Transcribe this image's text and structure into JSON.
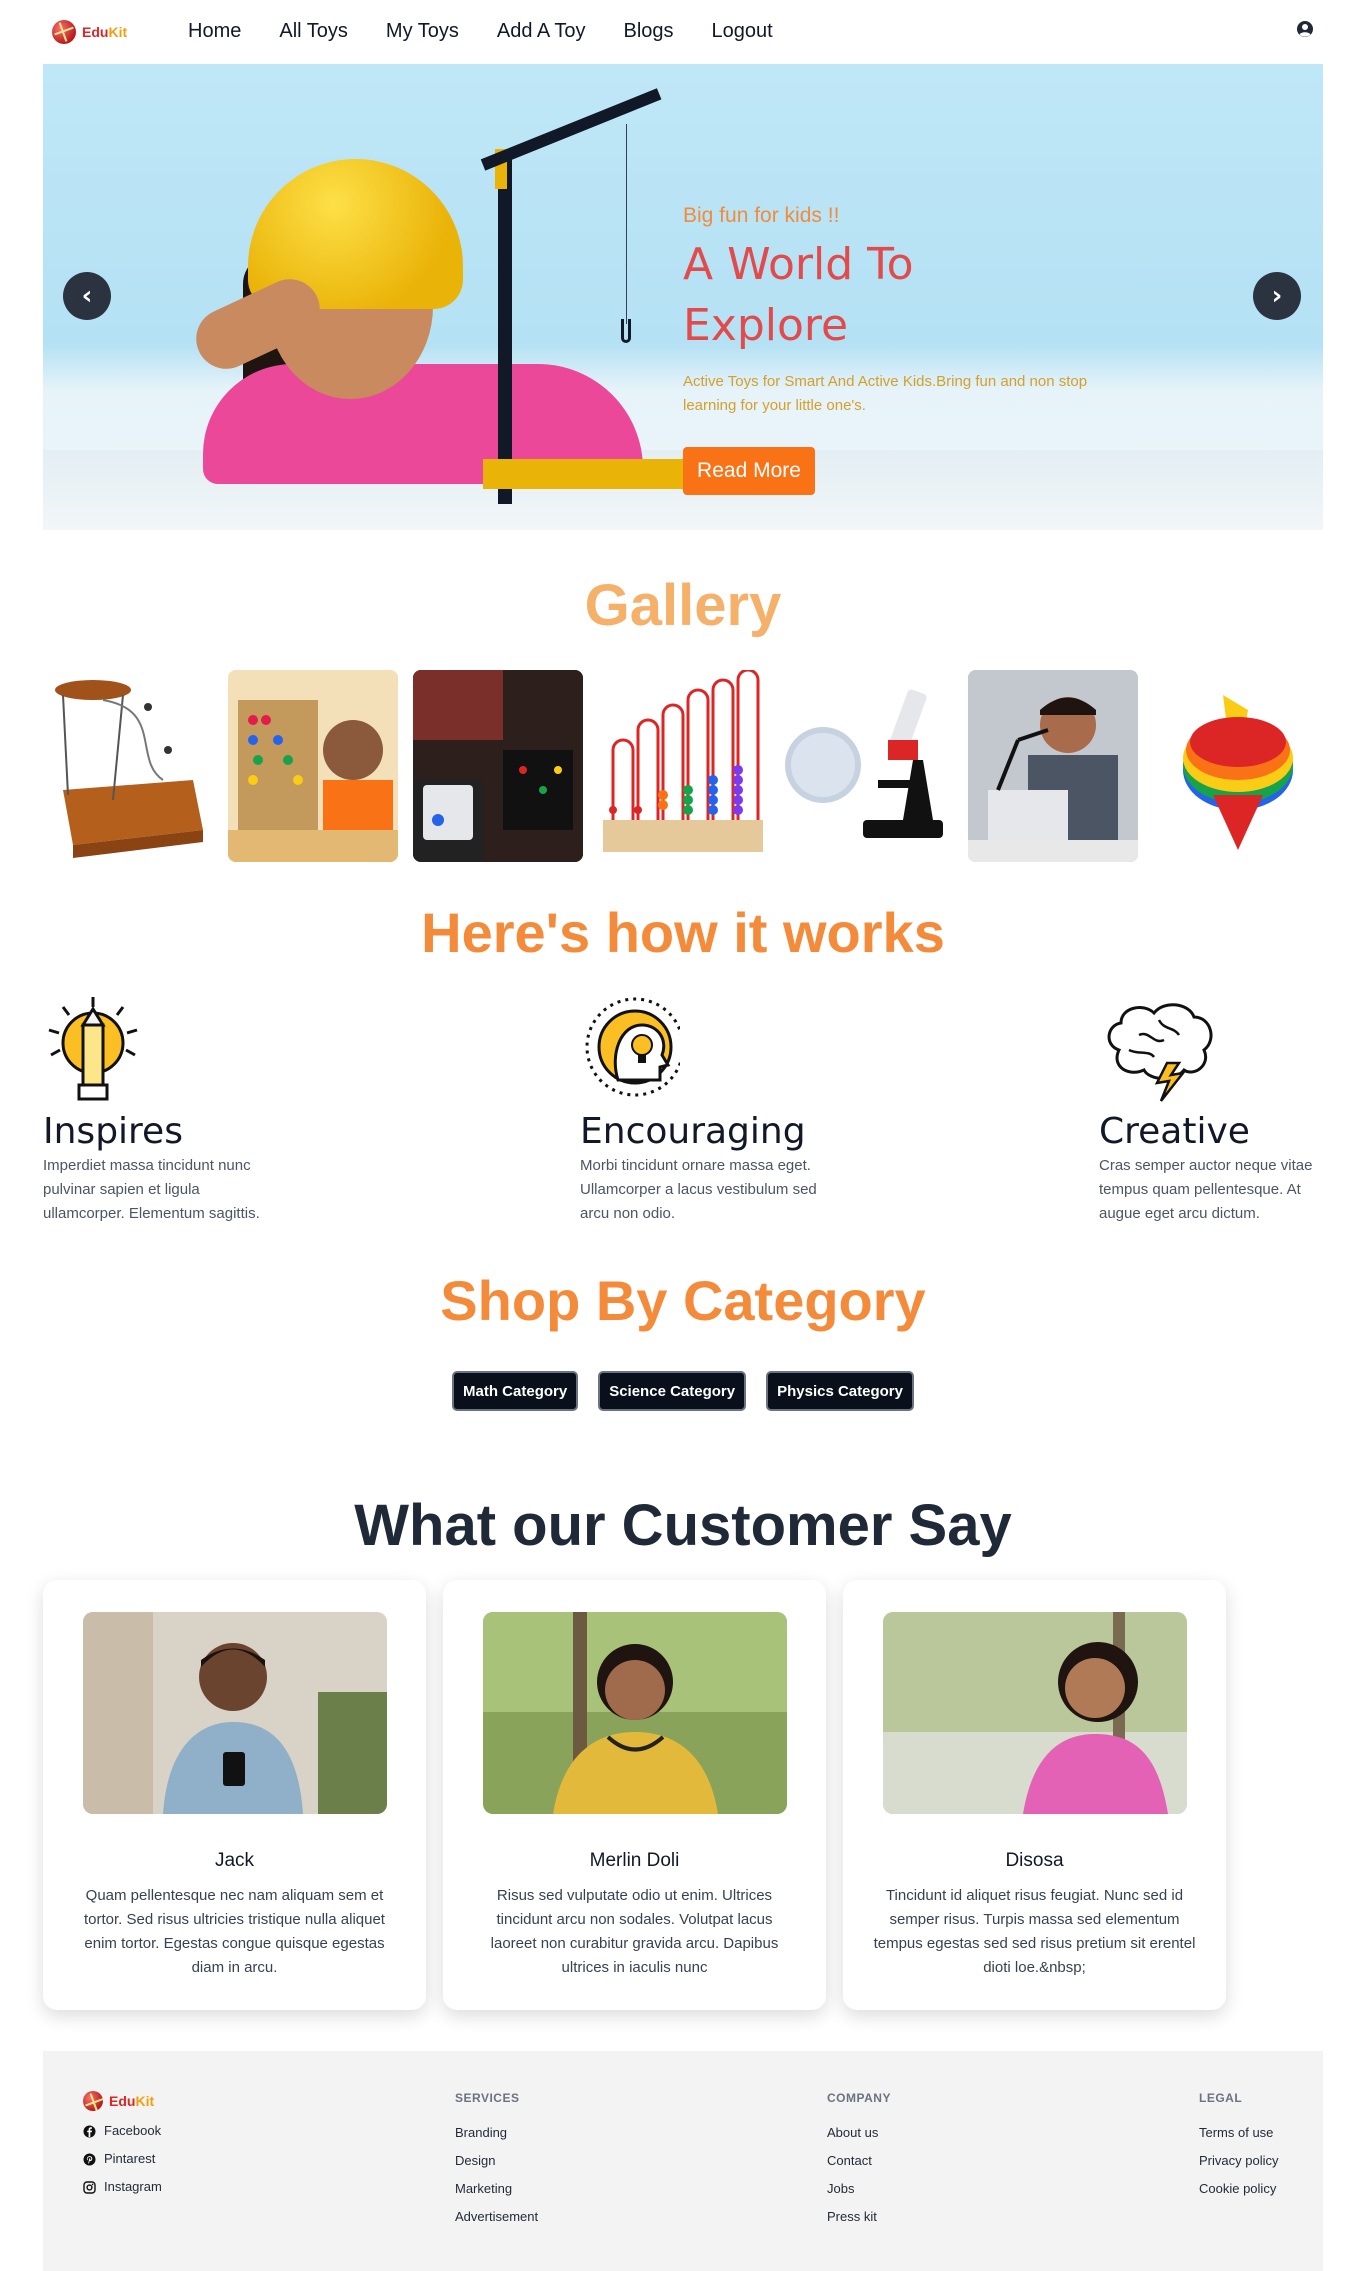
{
  "colors": {
    "accent": "#f97316",
    "title_orange": "#f38b3a",
    "hero_title": "#e24b4b",
    "dark_button": "#0a0f1c"
  },
  "brand": {
    "edu": "Edu",
    "kit": "Kit"
  },
  "nav": {
    "links": [
      "Home",
      "All Toys",
      "My Toys",
      "Add A Toy",
      "Blogs",
      "Logout"
    ],
    "user_icon": "user-circle-icon"
  },
  "hero": {
    "subtitle": "Big fun for kids !!",
    "title_line1": "A World To",
    "title_line2": "Explore",
    "description": "Active Toys for Smart And Active Kids.Bring fun and non stop learning for your little one's.",
    "button": "Read More",
    "prev_icon": "chevron-left-icon",
    "next_icon": "chevron-right-icon"
  },
  "gallery": {
    "title": "Gallery",
    "items": [
      "wooden-toy",
      "abacus-kid",
      "electronics-kit",
      "abacus",
      "microscope",
      "robot-kid",
      "spinning-top"
    ]
  },
  "how": {
    "title": "Here's how it works",
    "items": [
      {
        "title": "Inspires",
        "text": "Imperdiet massa tincidunt nunc pulvinar sapien et ligula ullamcorper. Elementum sagittis.",
        "icon": "pencil-bulb-icon"
      },
      {
        "title": "Encouraging",
        "text": "Morbi tincidunt ornare massa eget. Ullamcorper a lacus vestibulum sed arcu non odio.",
        "icon": "head-bulb-icon"
      },
      {
        "title": "Creative",
        "text": "Cras semper auctor neque vitae tempus quam pellentesque. At augue eget arcu dictum.",
        "icon": "brain-lightning-icon"
      }
    ]
  },
  "category": {
    "title": "Shop By Category",
    "buttons": [
      "Math Category",
      "Science Category",
      "Physics Category"
    ]
  },
  "testimonials": {
    "title": "What our Customer Say",
    "items": [
      {
        "name": "Jack",
        "text": "Quam pellentesque nec nam aliquam sem et tortor. Sed risus ultricies tristique nulla aliquet enim tortor. Egestas congue quisque egestas diam in arcu."
      },
      {
        "name": "Merlin Doli",
        "text": "Risus sed vulputate odio ut enim. Ultrices tincidunt arcu non sodales. Volutpat lacus laoreet non curabitur gravida arcu. Dapibus ultrices in iaculis nunc"
      },
      {
        "name": "Disosa",
        "text": "Tincidunt id aliquet risus feugiat. Nunc sed id semper risus. Turpis massa sed elementum tempus egestas sed sed risus pretium sit erentel dioti loe.&nbsp;"
      }
    ]
  },
  "footer": {
    "social": [
      "Facebook",
      "Pintarest",
      "Instagram"
    ],
    "services": {
      "heading": "SERVICES",
      "links": [
        "Branding",
        "Design",
        "Marketing",
        "Advertisement"
      ]
    },
    "company": {
      "heading": "COMPANY",
      "links": [
        "About us",
        "Contact",
        "Jobs",
        "Press kit"
      ]
    },
    "legal": {
      "heading": "LEGAL",
      "links": [
        "Terms of use",
        "Privacy policy",
        "Cookie policy"
      ]
    }
  }
}
